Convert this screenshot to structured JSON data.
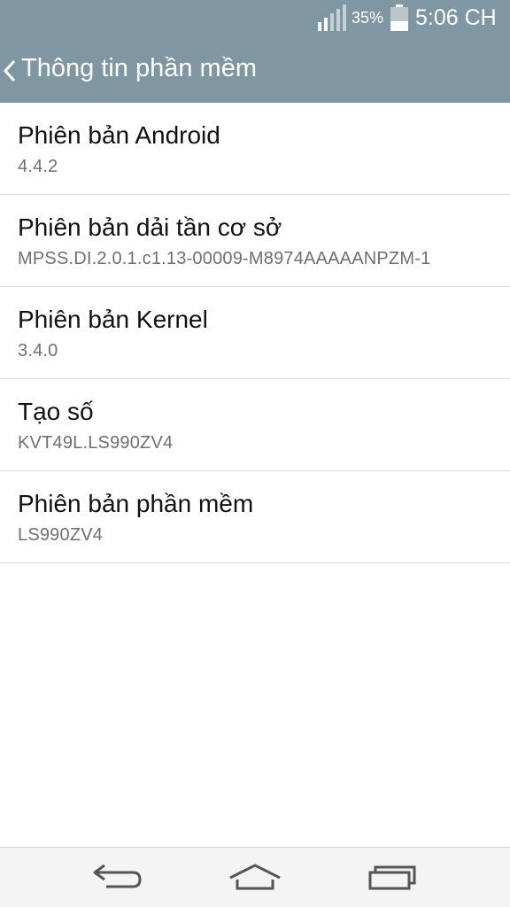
{
  "status_bar": {
    "battery_percent": "35%",
    "time": "5:06 CH",
    "icons": [
      "signal-icon",
      "battery-icon"
    ]
  },
  "action_bar": {
    "title": "Thông tin phần mềm",
    "back_icon": "chevron-left-icon"
  },
  "items": [
    {
      "title": "Phiên bản Android",
      "value": "4.4.2"
    },
    {
      "title": "Phiên bản dải tần cơ sở",
      "value": "MPSS.DI.2.0.1.c1.13-00009-M8974AAAAANPZM-1"
    },
    {
      "title": "Phiên bản Kernel",
      "value": "3.4.0"
    },
    {
      "title": "Tạo số",
      "value": "KVT49L.LS990ZV4"
    },
    {
      "title": "Phiên bản phần mềm",
      "value": "LS990ZV4"
    }
  ],
  "nav_bar": {
    "icons": [
      "back-arrow-icon",
      "home-icon",
      "recent-apps-icon"
    ]
  },
  "colors": {
    "header": "#7f97a3",
    "title_text": "#111111",
    "value_text": "#6f6f6f",
    "divider": "#dcdcdc",
    "nav_bar": "#f4f4f4"
  }
}
